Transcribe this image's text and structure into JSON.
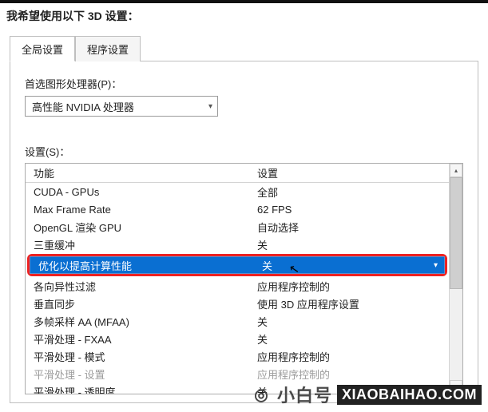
{
  "header": {
    "title": "我希望使用以下 3D 设置："
  },
  "tabs": {
    "global": "全局设置",
    "program": "程序设置"
  },
  "gpu": {
    "label": "首选图形处理器(P)：",
    "value": "高性能 NVIDIA 处理器"
  },
  "settings": {
    "label": "设置(S)：",
    "columns": {
      "feature": "功能",
      "setting": "设置"
    },
    "rows": [
      {
        "feature": "CUDA - GPUs",
        "setting": "全部"
      },
      {
        "feature": "Max Frame Rate",
        "setting": "62 FPS"
      },
      {
        "feature": "OpenGL 渲染 GPU",
        "setting": "自动选择"
      },
      {
        "feature": "三重缓冲",
        "setting": "关"
      }
    ],
    "selected": {
      "feature": "优化以提高计算性能",
      "setting": "关"
    },
    "rows2": [
      {
        "feature": "各向异性过滤",
        "setting": "应用程序控制的"
      },
      {
        "feature": "垂直同步",
        "setting": "使用 3D 应用程序设置"
      },
      {
        "feature": "多帧采样 AA (MFAA)",
        "setting": "关"
      },
      {
        "feature": "平滑处理 - FXAA",
        "setting": "关"
      },
      {
        "feature": "平滑处理 - 模式",
        "setting": "应用程序控制的"
      },
      {
        "feature": "平滑处理 - 设置",
        "setting": "应用程序控制的",
        "disabled": true
      },
      {
        "feature": "平滑处理 - 透明度",
        "setting": "关"
      }
    ]
  },
  "watermark": {
    "cn": "小白号",
    "en": "XIAOBAIHAO.COM"
  }
}
